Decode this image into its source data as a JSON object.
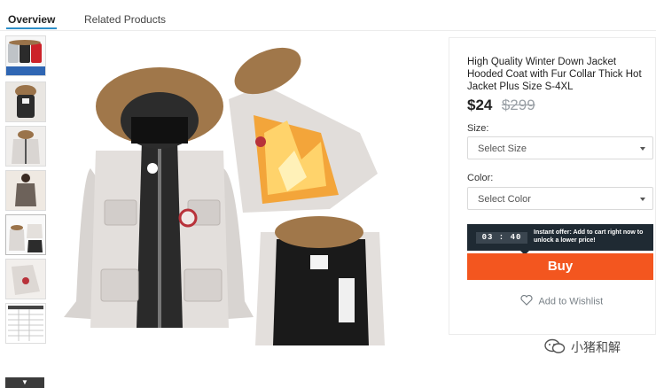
{
  "tabs": [
    {
      "label": "Overview",
      "active": true
    },
    {
      "label": "Related Products",
      "active": false
    }
  ],
  "thumbnails": [
    {
      "icon": "jackets-colors-thumbnail"
    },
    {
      "icon": "jacket-hood-thumbnail"
    },
    {
      "icon": "jacket-front-thumbnail"
    },
    {
      "icon": "jacket-model-thumbnail"
    },
    {
      "icon": "jacket-group-thumbnail"
    },
    {
      "icon": "jacket-detail-thumbnail"
    },
    {
      "icon": "size-chart-thumbnail"
    }
  ],
  "product": {
    "title": "High Quality Winter Down Jacket Hooded Coat with Fur Collar Thick Hot Jacket Plus Size S-4XL",
    "price": "$24",
    "original_price": "$299",
    "size_label": "Size:",
    "size_selected": "Select Size",
    "color_label": "Color:",
    "color_selected": "Select Color",
    "offer_timer": "03 : 40",
    "offer_text": "Instant offer: Add to cart right now to unlock a lower price!",
    "buy_label": "Buy",
    "wishlist_label": "Add to Wishlist"
  },
  "watermark": {
    "text": "小猪和解"
  },
  "colors": {
    "accent": "#2d8fc9",
    "buy": "#f3561f",
    "offer_bg": "#1f2a33",
    "jacket": "#e3dfdc",
    "fur": "#a0774a"
  }
}
